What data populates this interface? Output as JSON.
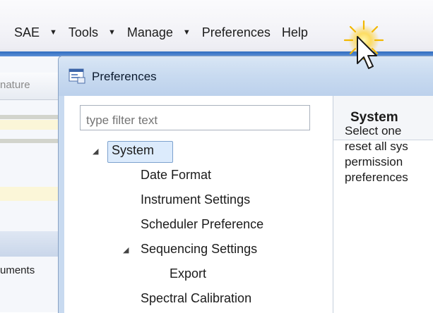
{
  "menubar": {
    "items": [
      {
        "label": "SAE",
        "dropdown": true
      },
      {
        "label": "Tools",
        "dropdown": true
      },
      {
        "label": "Manage",
        "dropdown": true
      },
      {
        "label": "Preferences",
        "dropdown": false
      },
      {
        "label": "Help",
        "dropdown": false
      }
    ]
  },
  "background": {
    "tab_label": "nature",
    "list_label": "uments"
  },
  "dialog": {
    "title": "Preferences",
    "filter_placeholder": "type filter text",
    "tree": [
      {
        "label": "System",
        "level": 0,
        "expanded": true,
        "selected": true
      },
      {
        "label": "Date Format",
        "level": 1
      },
      {
        "label": "Instrument Settings",
        "level": 1
      },
      {
        "label": "Scheduler Preference",
        "level": 1
      },
      {
        "label": "Sequencing Settings",
        "level": 1,
        "expanded": true
      },
      {
        "label": "Export",
        "level": 2
      },
      {
        "label": "Spectral Calibration",
        "level": 1
      }
    ],
    "page": {
      "title": "System",
      "description_lines": [
        "Select one",
        "reset all sys",
        "permission",
        "preferences"
      ]
    }
  },
  "colors": {
    "titlebar": "#c8daf0",
    "selection": "#dcebfc",
    "accent_blue": "#2f6cc0"
  },
  "icons": {
    "caret": "caret-down-icon",
    "dialog": "preferences-window-icon",
    "cursor": "mouse-pointer-icon"
  }
}
